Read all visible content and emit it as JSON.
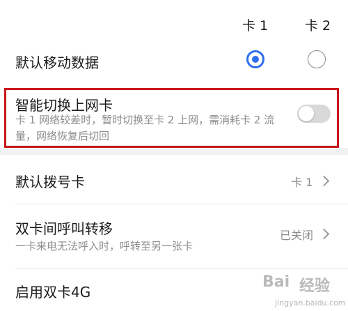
{
  "header": {
    "sim1": "卡 1",
    "sim2": "卡 2"
  },
  "default_data": {
    "label": "默认移动数据",
    "selected": "sim1"
  },
  "smart_switch": {
    "label": "智能切换上网卡",
    "description": "卡 1 网络较差时，暂时切换至卡 2 上网，需消耗卡 2 流量，网络恢复后切回",
    "enabled": false
  },
  "default_dial": {
    "label": "默认拨号卡",
    "value": "卡 1"
  },
  "call_forward": {
    "label": "双卡间呼叫转移",
    "description": "一卡来电无法呼入时，呼转至另一张卡",
    "value": "已关闭"
  },
  "dual_4g": {
    "label": "启用双卡4G"
  },
  "watermark": {
    "brand": "Bai",
    "brand2": "经验",
    "url": "jingyan.baidu.com"
  },
  "colors": {
    "accent": "#2f6fed",
    "highlight": "#c8161d"
  }
}
